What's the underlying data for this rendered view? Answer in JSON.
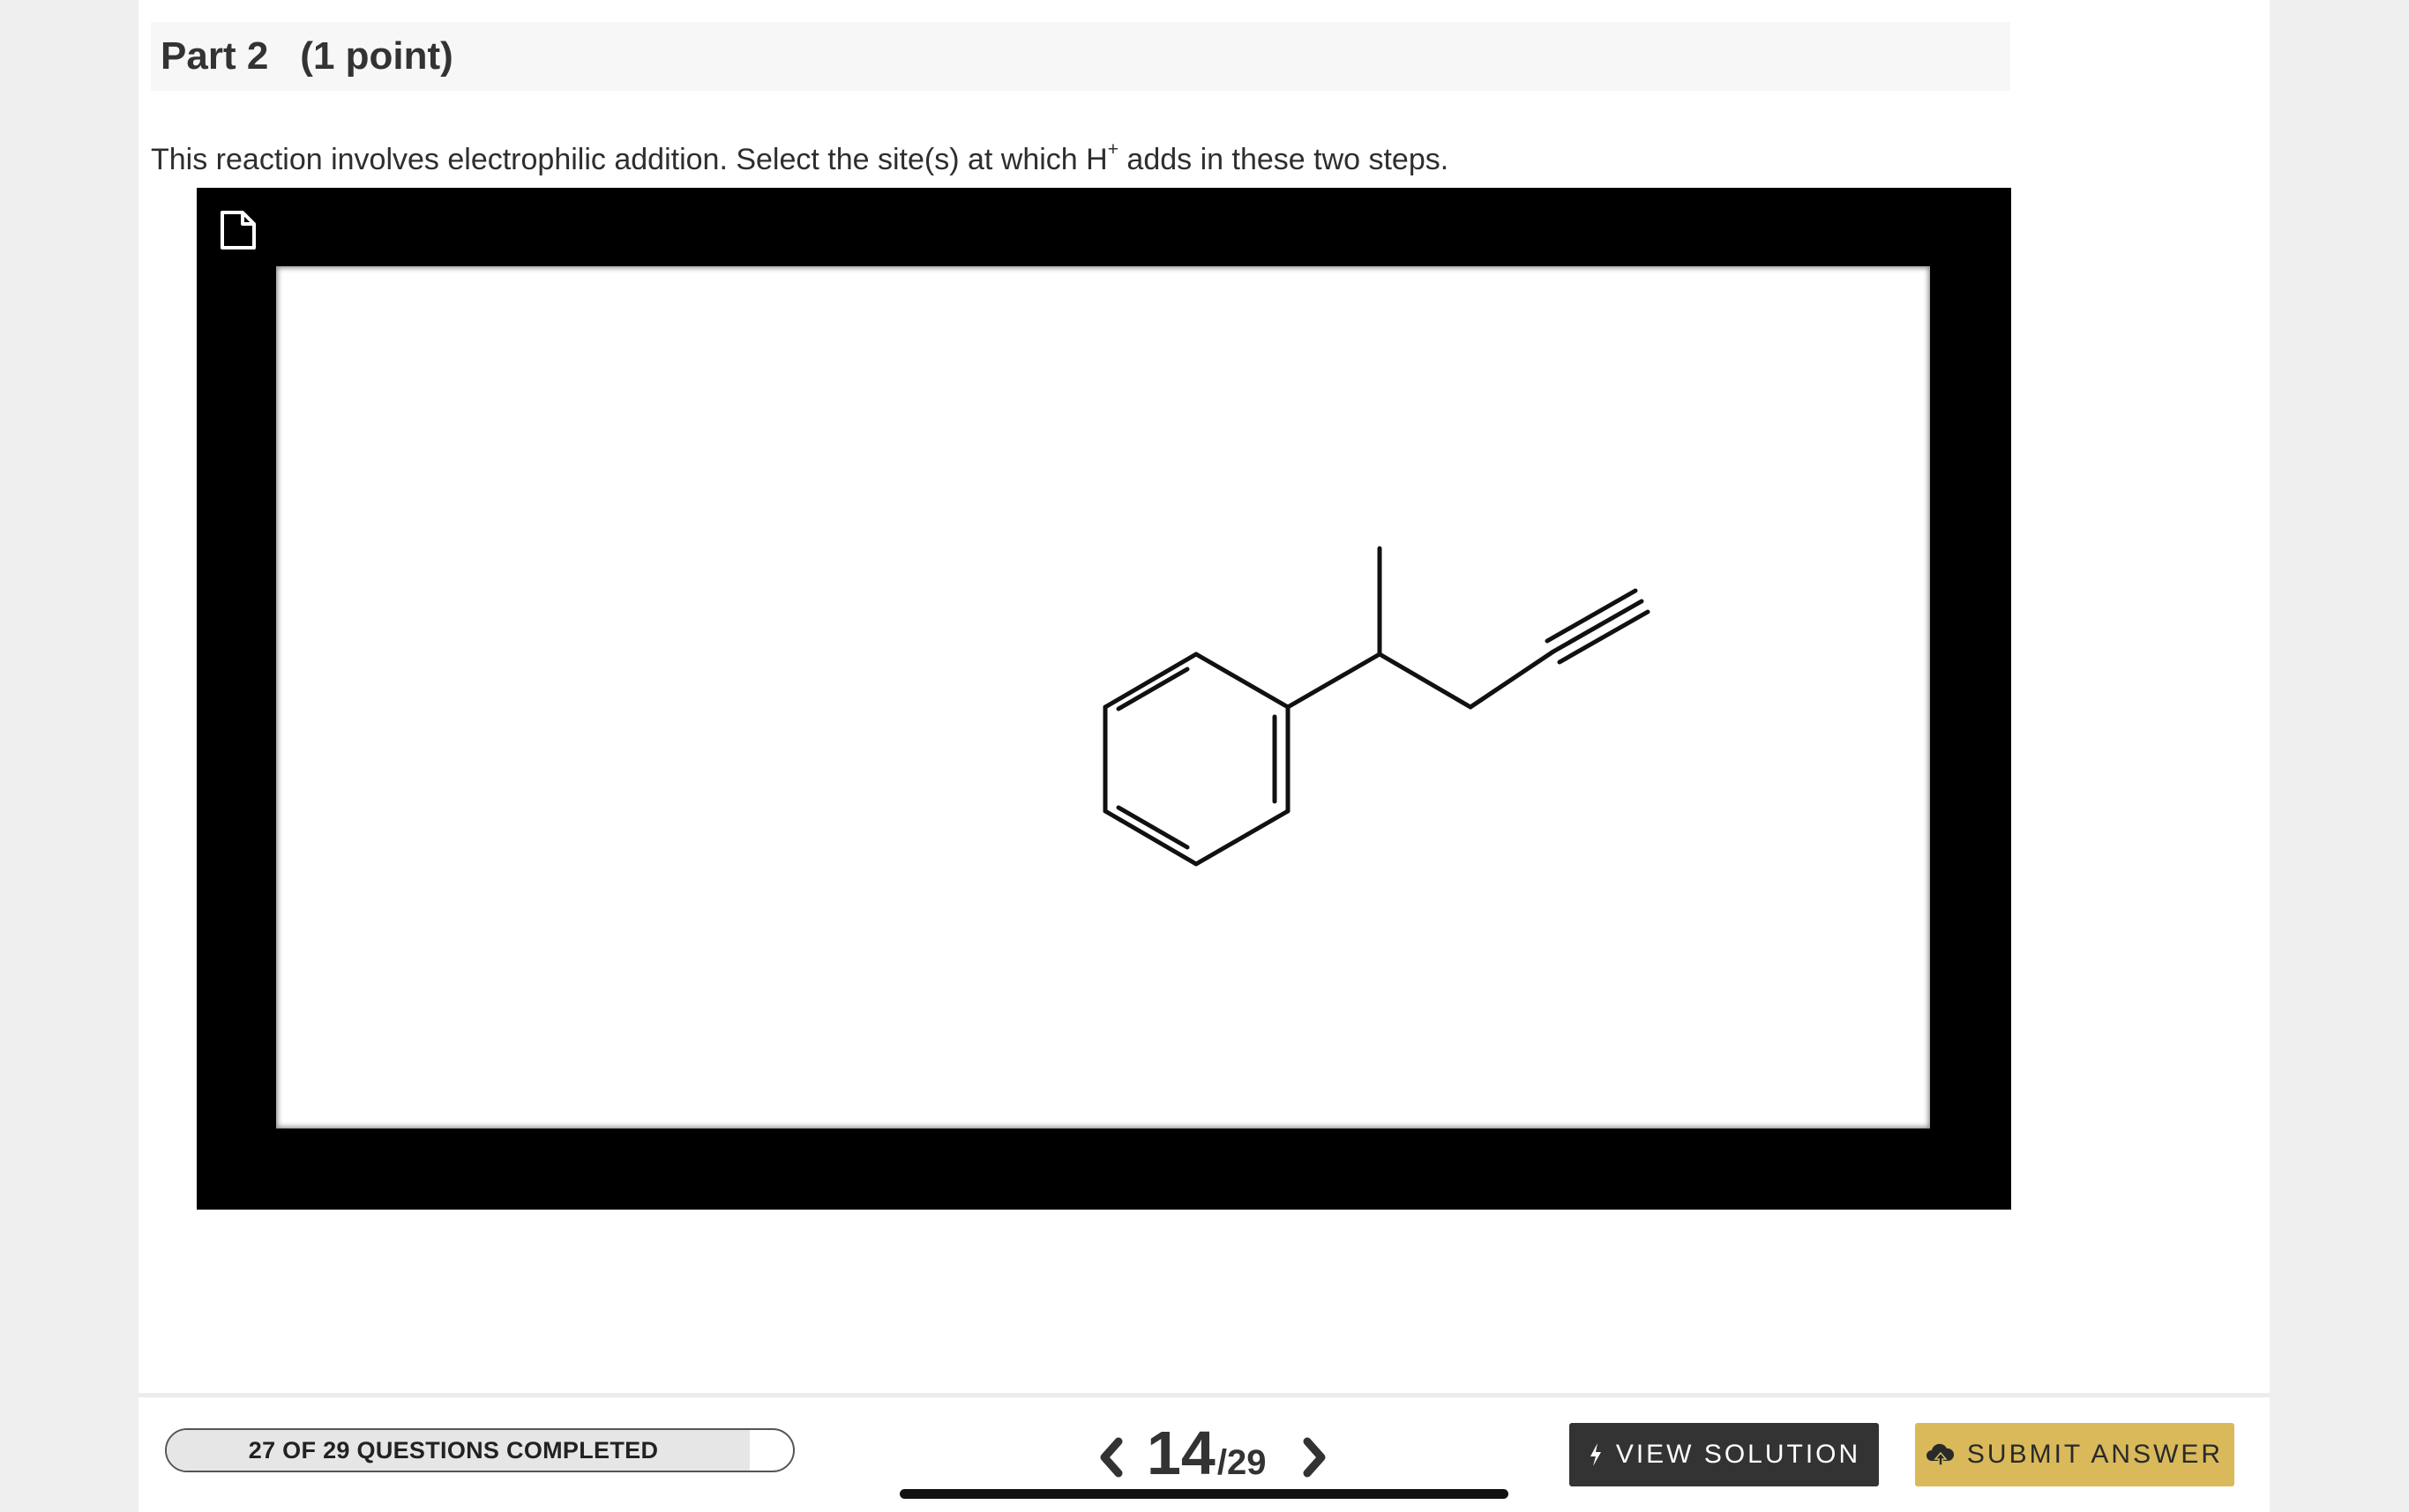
{
  "part": {
    "title": "Part 2",
    "points": "(1 point)"
  },
  "question": {
    "text_before": "This reaction involves electrophilic addition. Select the site(s) at which H",
    "superscript": "+",
    "text_after": " adds in these two steps."
  },
  "viewer": {
    "icon": "document-icon"
  },
  "footer": {
    "progress_label": "27 OF 29 QUESTIONS COMPLETED",
    "progress_fraction": 0.931,
    "current_page": "14",
    "total_pages": "/29",
    "prev_icon": "chevron-left-icon",
    "next_icon": "chevron-right-icon",
    "view_solution_label": "VIEW SOLUTION",
    "view_solution_icon": "lightning-icon",
    "submit_label": "SUBMIT ANSWER",
    "submit_icon": "cloud-upload-icon"
  },
  "colors": {
    "submit_button": "#d9b95a",
    "view_solution_button": "#333333",
    "viewer_frame": "#000000"
  }
}
